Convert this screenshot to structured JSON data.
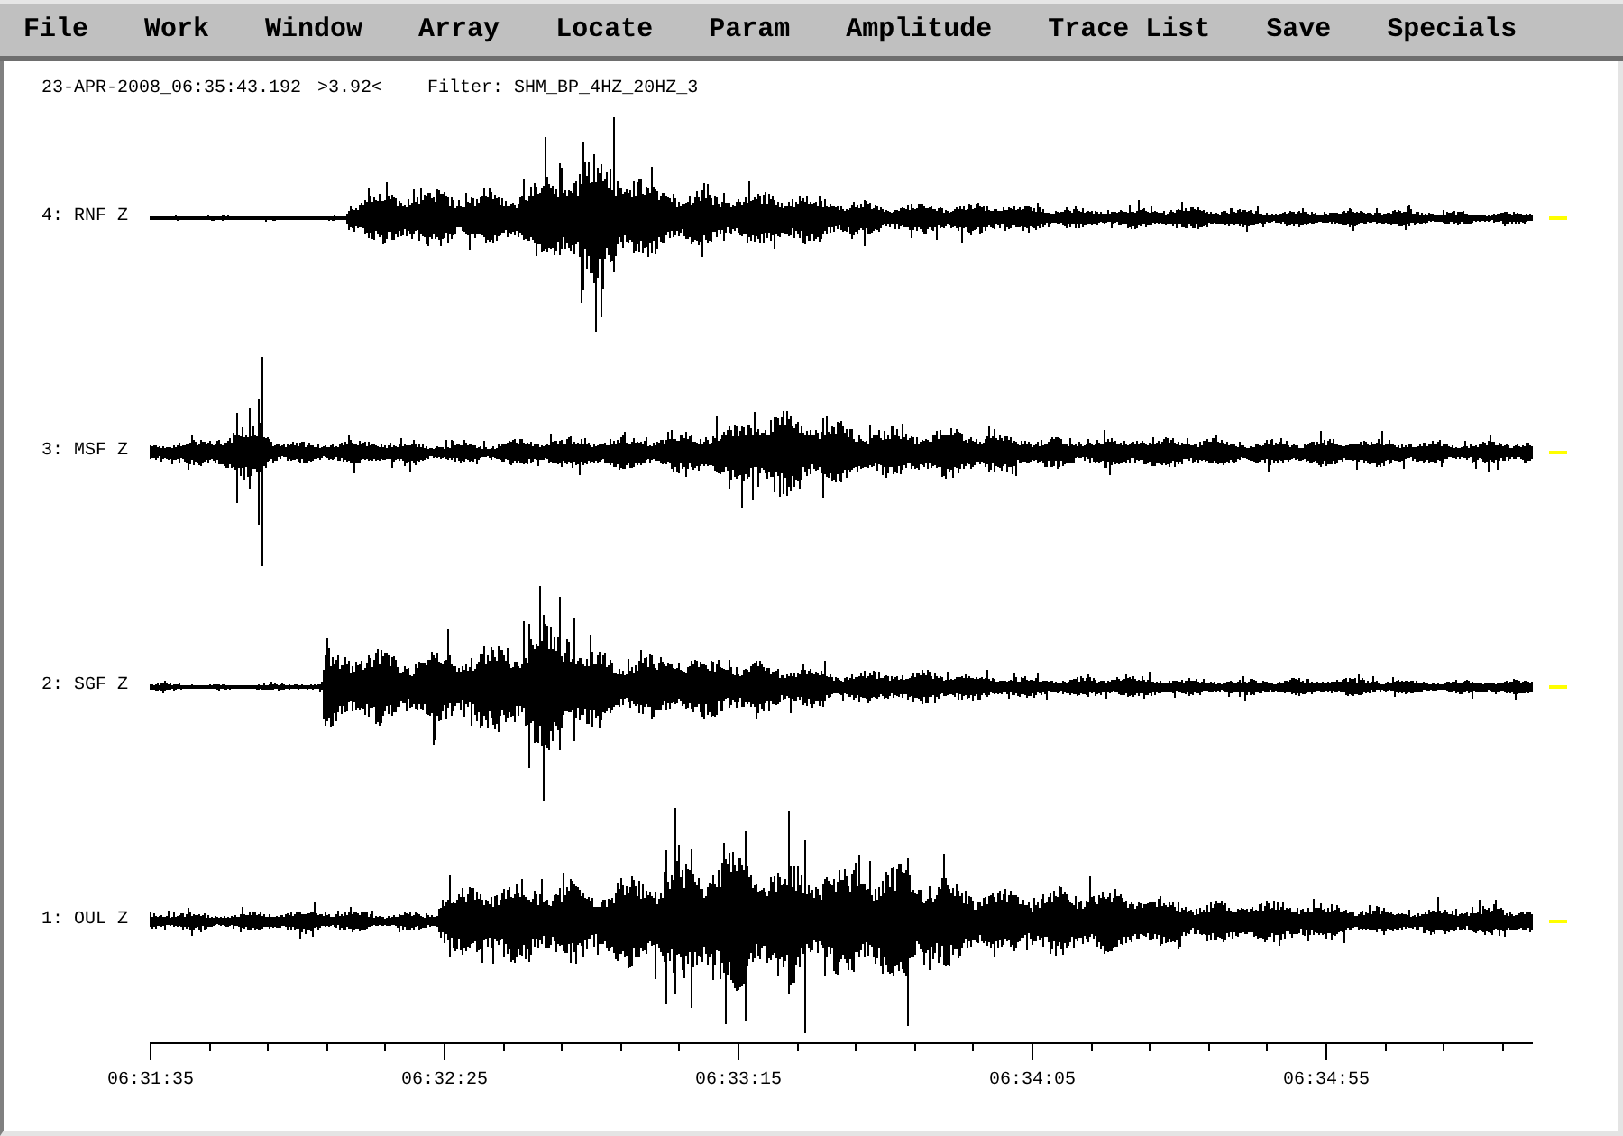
{
  "menu": [
    "File",
    "Work",
    "Window",
    "Array",
    "Locate",
    "Param",
    "Amplitude",
    "Trace List",
    "Save",
    "Specials"
  ],
  "header": {
    "timestamp": "23-APR-2008_06:35:43.192",
    "reading": ">3.92<",
    "filter": "Filter: SHM_BP_4HZ_20HZ_3"
  },
  "traces": [
    {
      "label": "4: RNF Z"
    },
    {
      "label": "3: MSF Z"
    },
    {
      "label": "2: SGF Z"
    },
    {
      "label": "1: OUL Z"
    }
  ],
  "time_axis": {
    "tick_labels": [
      "06:31:35",
      "06:32:25",
      "06:33:15",
      "06:34:05",
      "06:34:55"
    ]
  }
}
